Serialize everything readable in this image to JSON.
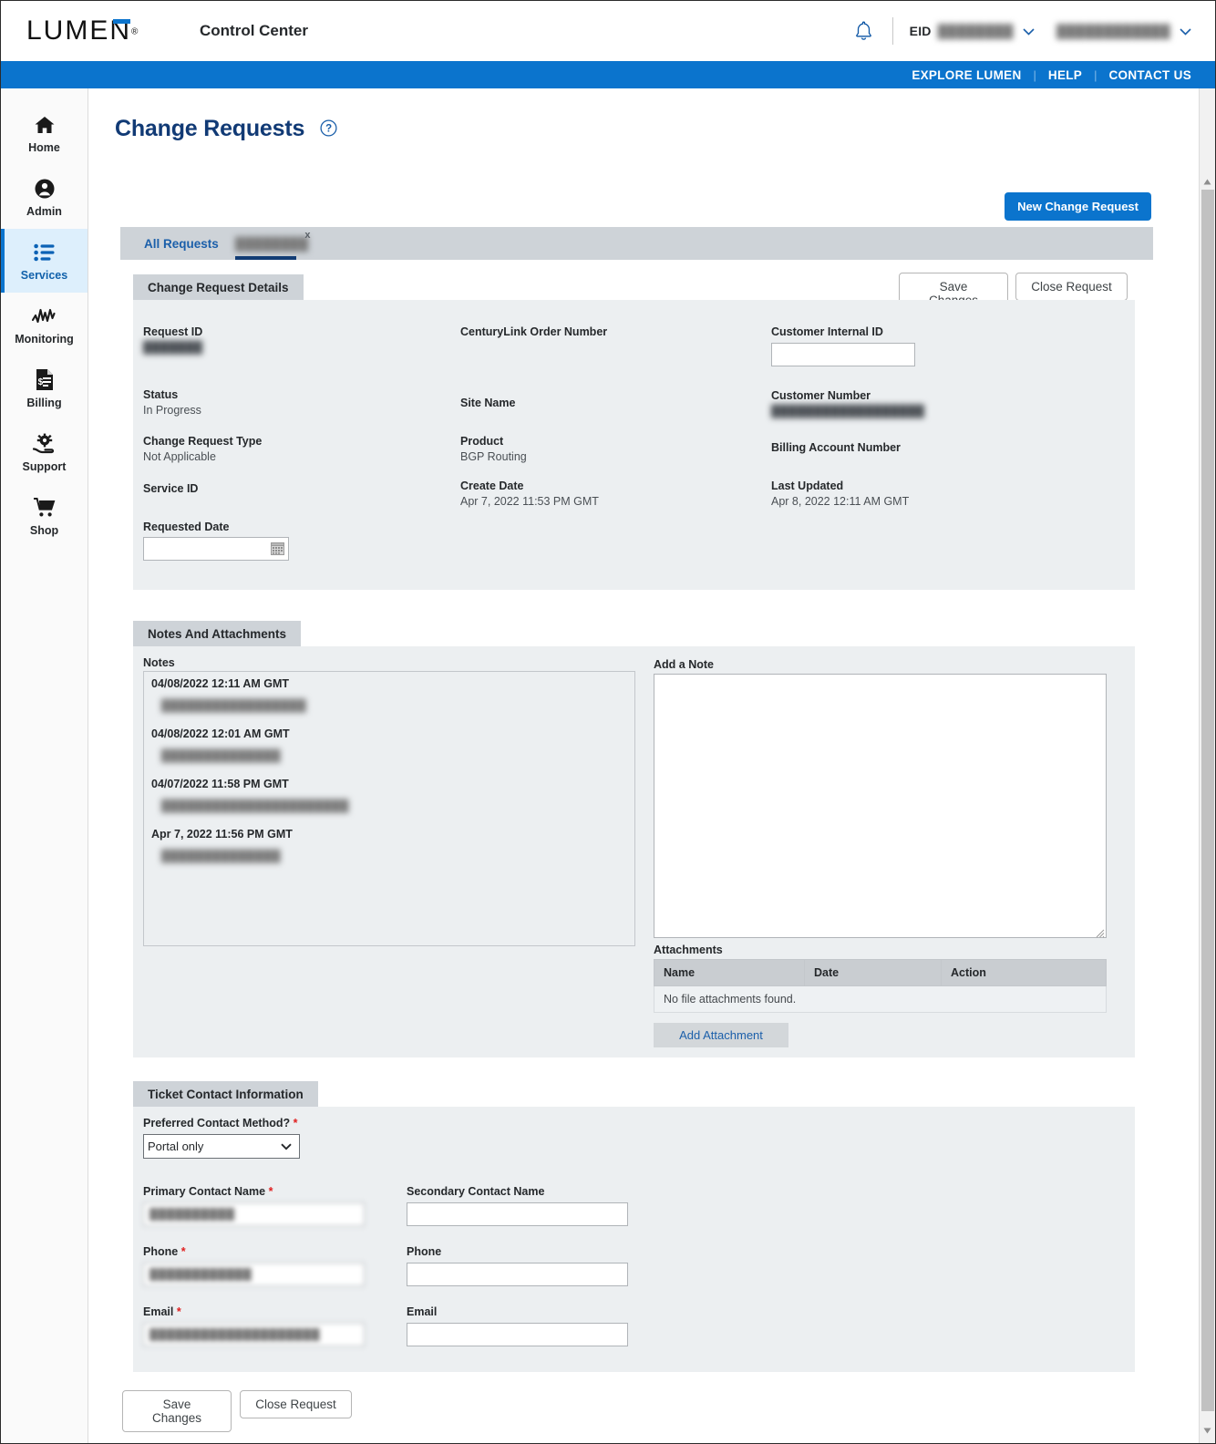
{
  "header": {
    "logo_text": "LUMEN",
    "logo_registered": "®",
    "app_title": "Control Center",
    "bell_icon": "notification-bell-icon",
    "eid_label": "EID",
    "eid_value_redacted": "████████",
    "account_value_redacted": "████████████",
    "chevron_icon": "chevron-down-icon"
  },
  "bluebar": {
    "explore": "EXPLORE LUMEN",
    "help": "HELP",
    "contact": "CONTACT US",
    "separator": "|",
    "bg_color": "#0b74cd"
  },
  "sidebar": {
    "items": [
      {
        "label": "Home",
        "icon": "home-icon",
        "active": false
      },
      {
        "label": "Admin",
        "icon": "user-circle-icon",
        "active": false
      },
      {
        "label": "Services",
        "icon": "list-icon",
        "active": true
      },
      {
        "label": "Monitoring",
        "icon": "activity-line-icon",
        "active": false
      },
      {
        "label": "Billing",
        "icon": "invoice-document-icon",
        "active": false
      },
      {
        "label": "Support",
        "icon": "gear-hand-icon",
        "active": false
      },
      {
        "label": "Shop",
        "icon": "shopping-cart-icon",
        "active": false
      }
    ],
    "active_bg": "#ddeffc",
    "active_color": "#1161ab"
  },
  "page": {
    "title": "Change Requests",
    "help_icon": "question-mark-circle-icon",
    "new_request_button": "New Change Request"
  },
  "tabs": {
    "all_requests": "All Requests",
    "active_tab_redacted": "████████",
    "close_icon": "x",
    "underline_color": "#123c74"
  },
  "actions": {
    "save_changes": "Save Changes",
    "close_request": "Close Request"
  },
  "details": {
    "panel_title": "Change Request Details",
    "fields": [
      {
        "label": "Request ID",
        "value": "███████",
        "redacted": true
      },
      {
        "label": "Status",
        "value": "In Progress"
      },
      {
        "label": "Change Request Type",
        "value": "Not Applicable"
      },
      {
        "label": "Service ID",
        "value": ""
      },
      {
        "label": "Requested Date",
        "value": "",
        "input": true,
        "calendar_icon": "calendar-icon"
      },
      {
        "label": "CenturyLink Order Number",
        "value": ""
      },
      {
        "label": "Site Name",
        "value": ""
      },
      {
        "label": "Product",
        "value": "BGP Routing"
      },
      {
        "label": "Create Date",
        "value": "Apr 7, 2022 11:53 PM GMT"
      },
      {
        "label": "Customer Internal ID",
        "value": "",
        "input": true
      },
      {
        "label": "Customer Number",
        "value": "██████████████████",
        "redacted": true
      },
      {
        "label": "Billing Account Number",
        "value": ""
      },
      {
        "label": "Last Updated",
        "value": "Apr 8, 2022 12:11 AM GMT"
      }
    ]
  },
  "notes": {
    "panel_title": "Notes And Attachments",
    "notes_label": "Notes",
    "items": [
      {
        "date": "04/08/2022 12:11 AM GMT",
        "text": "█████████████████",
        "redacted": true
      },
      {
        "date": "04/08/2022 12:01 AM GMT",
        "text": "██████████████",
        "redacted": true
      },
      {
        "date": "04/07/2022 11:58 PM GMT",
        "text": "██████████████████████",
        "redacted": true
      },
      {
        "date": "Apr 7, 2022 11:56 PM GMT",
        "text": "██████████████",
        "redacted": true
      }
    ],
    "add_note_label": "Add a Note",
    "add_note_value": "",
    "attachments_label": "Attachments",
    "attachment_columns": [
      "Name",
      "Date",
      "Action"
    ],
    "attachments_empty": "No file attachments found.",
    "add_attachment_button": "Add Attachment"
  },
  "contact": {
    "panel_title": "Ticket Contact Information",
    "preferred_method_label": "Preferred Contact Method?",
    "preferred_method_value": "Portal only",
    "preferred_method_options": [
      "Portal only"
    ],
    "primary_contact_name_label": "Primary Contact Name",
    "primary_contact_name_value": "██████████",
    "secondary_contact_name_label": "Secondary Contact Name",
    "secondary_contact_name_value": "",
    "primary_phone_label": "Phone",
    "primary_phone_value": "████████████",
    "secondary_phone_label": "Phone",
    "secondary_phone_value": "",
    "primary_email_label": "Email",
    "primary_email_value": "████████████████████",
    "secondary_email_label": "Email",
    "secondary_email_value": "",
    "required_marker": "*"
  },
  "footer": {
    "save_changes": "Save Changes",
    "close_request": "Close Request"
  },
  "scrollbar": {
    "up_icon": "triangle-up-icon",
    "down_icon": "triangle-down-icon"
  }
}
